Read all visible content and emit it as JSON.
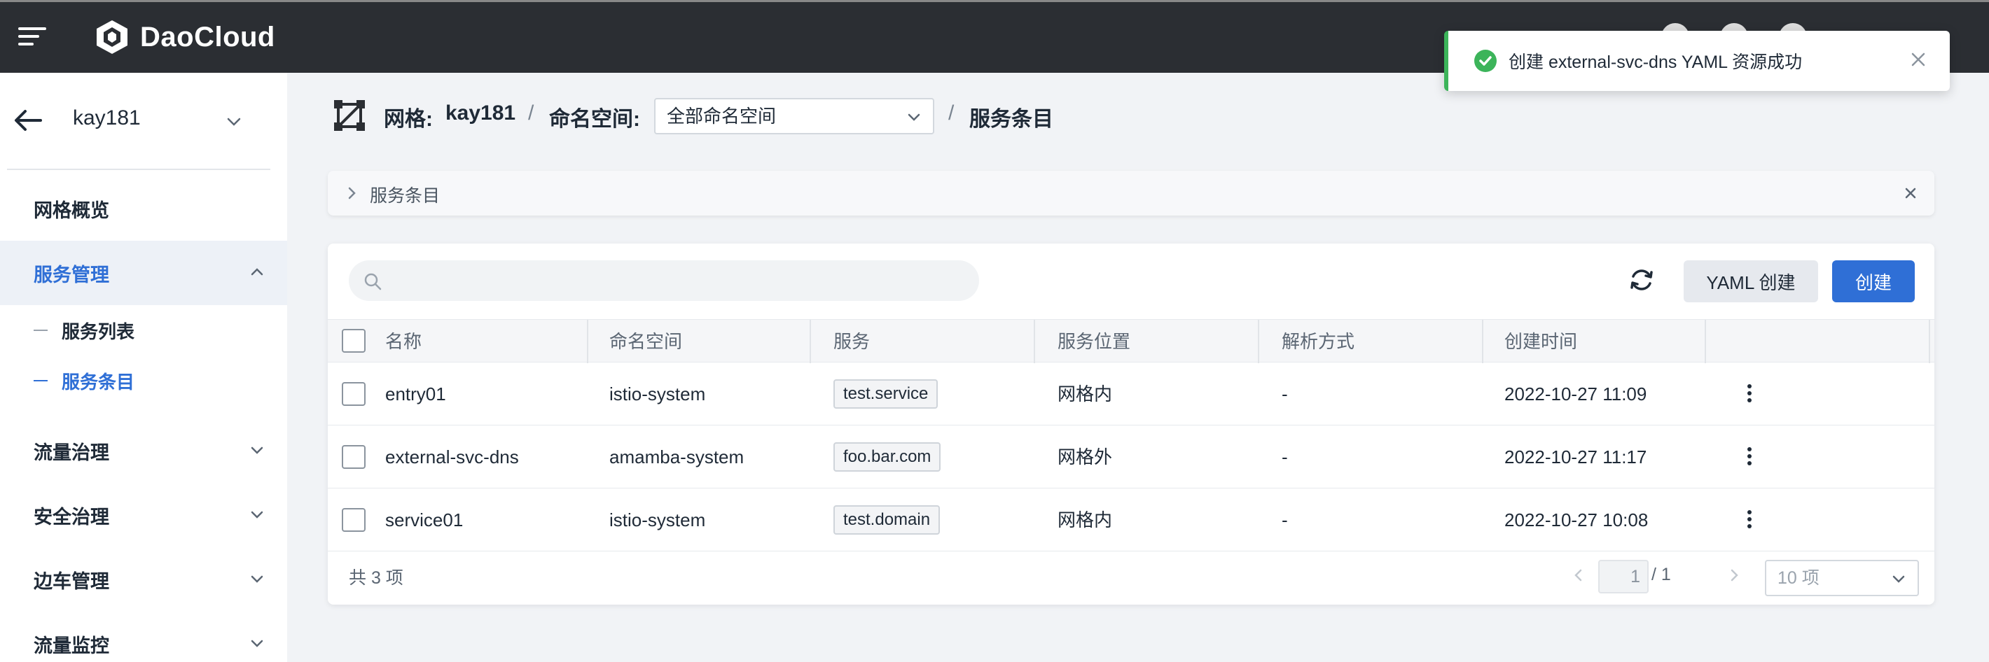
{
  "app": {
    "brand": "DaoCloud"
  },
  "toast": {
    "message": "创建 external-svc-dns YAML 资源成功",
    "status_color": "#3cb45a"
  },
  "sidebar": {
    "mesh_name": "kay181",
    "items": [
      {
        "label": "网格概览"
      },
      {
        "label": "服务管理"
      },
      {
        "label": "服务列表"
      },
      {
        "label": "服务条目"
      },
      {
        "label": "流量治理"
      },
      {
        "label": "安全治理"
      },
      {
        "label": "边车管理"
      },
      {
        "label": "流量监控"
      }
    ]
  },
  "header": {
    "mesh_label": "网格:",
    "mesh_value": "kay181",
    "sep": "/",
    "namespace_label": "命名空间:",
    "namespace_value": "全部命名空间",
    "page_title": "服务条目"
  },
  "infobar": {
    "label": "服务条目"
  },
  "toolbar": {
    "search_placeholder": "",
    "yaml_create_label": "YAML 创建",
    "create_label": "创建"
  },
  "table": {
    "columns": [
      "名称",
      "命名空间",
      "服务",
      "服务位置",
      "解析方式",
      "创建时间"
    ],
    "rows": [
      {
        "name": "entry01",
        "namespace": "istio-system",
        "service": "test.service",
        "location": "网格内",
        "resolution": "-",
        "created": "2022-10-27 11:09"
      },
      {
        "name": "external-svc-dns",
        "namespace": "amamba-system",
        "service": "foo.bar.com",
        "location": "网格外",
        "resolution": "-",
        "created": "2022-10-27 11:17"
      },
      {
        "name": "service01",
        "namespace": "istio-system",
        "service": "test.domain",
        "location": "网格内",
        "resolution": "-",
        "created": "2022-10-27 10:08"
      }
    ]
  },
  "pagination": {
    "total": "共 3 项",
    "current": "1",
    "of": "/ 1",
    "page_size": "10 项"
  },
  "colors": {
    "accent": "#2f6fd6",
    "topbar": "#2b2e33"
  }
}
